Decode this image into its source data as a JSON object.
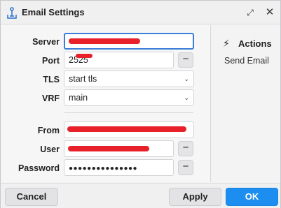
{
  "window": {
    "title": "Email Settings",
    "restore_glyph": "⤢",
    "close_glyph": "✕",
    "icon": "pitchfork-icon"
  },
  "form": {
    "server": {
      "label": "Server",
      "value": ""
    },
    "port": {
      "label": "Port",
      "value": "2525",
      "minus": "−"
    },
    "tls": {
      "label": "TLS",
      "value": "start tls"
    },
    "vrf": {
      "label": "VRF",
      "value": "main"
    },
    "from": {
      "label": "From",
      "value": ""
    },
    "user": {
      "label": "User",
      "value": "",
      "minus": "−"
    },
    "password": {
      "label": "Password",
      "value": "●●●●●●●●●●●●●●●",
      "minus": "−"
    }
  },
  "actions": {
    "heading": "Actions",
    "bolt": "⚡",
    "items": [
      "Send Email"
    ]
  },
  "footer": {
    "cancel": "Cancel",
    "apply": "Apply",
    "ok": "OK"
  },
  "colors": {
    "accent": "#1b8ef0",
    "focus": "#3b7dd8",
    "redaction": "#e8202a"
  }
}
